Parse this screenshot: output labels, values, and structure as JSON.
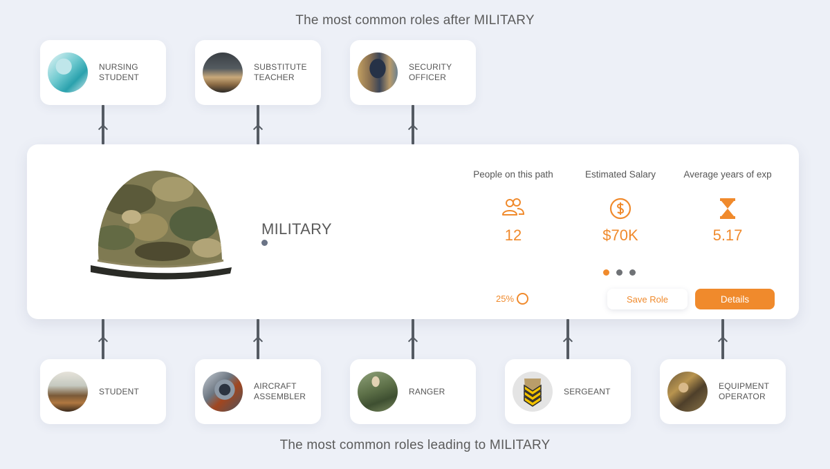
{
  "headings": {
    "after": "The most common roles after MILITARY",
    "leading": "The most common roles leading to MILITARY"
  },
  "roles_after": [
    {
      "label": "NURSING STUDENT",
      "icon": "nursing-student-photo"
    },
    {
      "label": "SUBSTITUTE TEACHER",
      "icon": "substitute-teacher-photo"
    },
    {
      "label": "SECURITY OFFICER",
      "icon": "security-officer-photo"
    }
  ],
  "roles_before": [
    {
      "label": "STUDENT",
      "icon": "student-photo"
    },
    {
      "label": "AIRCRAFT ASSEMBLER",
      "icon": "aircraft-assembler-photo"
    },
    {
      "label": "RANGER",
      "icon": "ranger-photo"
    },
    {
      "label": "SERGEANT",
      "icon": "sergeant-chevron-icon"
    },
    {
      "label": "EQUIPMENT OPERATOR",
      "icon": "equipment-operator-photo"
    }
  ],
  "current_role": {
    "title": "MILITARY",
    "image": "military-helmet-photo",
    "stats": [
      {
        "label": "People on this path",
        "value": "12",
        "icon": "people-icon"
      },
      {
        "label": "Estimated Salary",
        "value": "$70K",
        "icon": "dollar-icon"
      },
      {
        "label": "Average years of exp",
        "value": "5.17",
        "icon": "hourglass-icon"
      }
    ],
    "progress": "25%",
    "progress_fraction": 0.25,
    "pager": {
      "count": 3,
      "active": 0
    },
    "save_label": "Save Role",
    "details_label": "Details"
  },
  "colors": {
    "accent": "#f08a2c",
    "background": "#edf0f7",
    "connector": "#555b63"
  }
}
